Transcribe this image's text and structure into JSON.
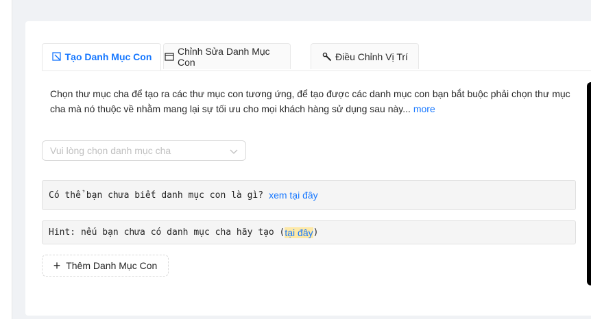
{
  "tabs": [
    {
      "label": "Tạo Danh Mục Con",
      "icon": "edit-square-icon",
      "active": true
    },
    {
      "label": "Chỉnh Sửa Danh Mục Con",
      "icon": "window-icon",
      "active": false
    },
    {
      "label": "Điều Chỉnh Vị Trí",
      "icon": "wrench-icon",
      "active": false
    }
  ],
  "description": {
    "text": "Chọn thư mục cha để tạo ra các thư mục con tương ứng, để tạo được các danh mục con bạn bắt buộc phải chọn thư mục cha mà nó thuộc về nhằm mang lại sự tối ưu cho mọi khách hàng sử dụng sau này...",
    "more": "more"
  },
  "select": {
    "placeholder": "Vui lòng chọn danh mục cha"
  },
  "info": {
    "text": "Có thể bạn chưa biết danh mục con là gì?",
    "link": "xem tại đây"
  },
  "hint": {
    "prefix": "Hint: nếu bạn chưa có danh mục cha hãy tạo (",
    "link": "tại đây",
    "suffix": ")"
  },
  "add_button": {
    "label": "Thêm Danh Mục Con"
  },
  "colors": {
    "accent": "#1677ff",
    "highlight": "#fde9a8"
  }
}
